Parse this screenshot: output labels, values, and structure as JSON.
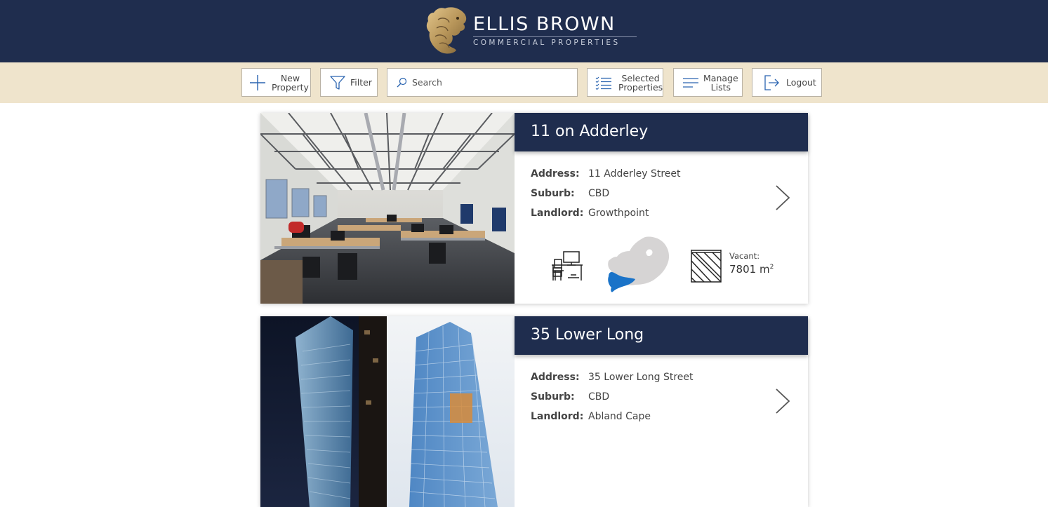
{
  "brand": {
    "name": "ELLIS BROWN",
    "tagline": "COMMERCIAL PROPERTIES"
  },
  "toolbar": {
    "new_property": "New\nProperty",
    "filter": "Filter",
    "search_placeholder": "Search",
    "selected_properties": "Selected\nProperties",
    "manage_lists": "Manage\nLists",
    "logout": "Logout"
  },
  "labels": {
    "address": "Address:",
    "suburb": "Suburb:",
    "landlord": "Landlord:",
    "vacant": "Vacant:"
  },
  "properties": [
    {
      "name": "11 on Adderley",
      "address": "11 Adderley Street",
      "suburb": "CBD",
      "landlord": "Growthpoint",
      "vacant_area": "7801 m",
      "vacant_unit_sup": "2"
    },
    {
      "name": "35 Lower Long",
      "address": "35 Lower Long Street",
      "suburb": "CBD",
      "landlord": "Abland Cape"
    }
  ],
  "colors": {
    "header_bg": "#1f2d4e",
    "toolbar_bg": "#efe4cc",
    "gold": "#b8965a",
    "map_highlight": "#1a73c8"
  }
}
